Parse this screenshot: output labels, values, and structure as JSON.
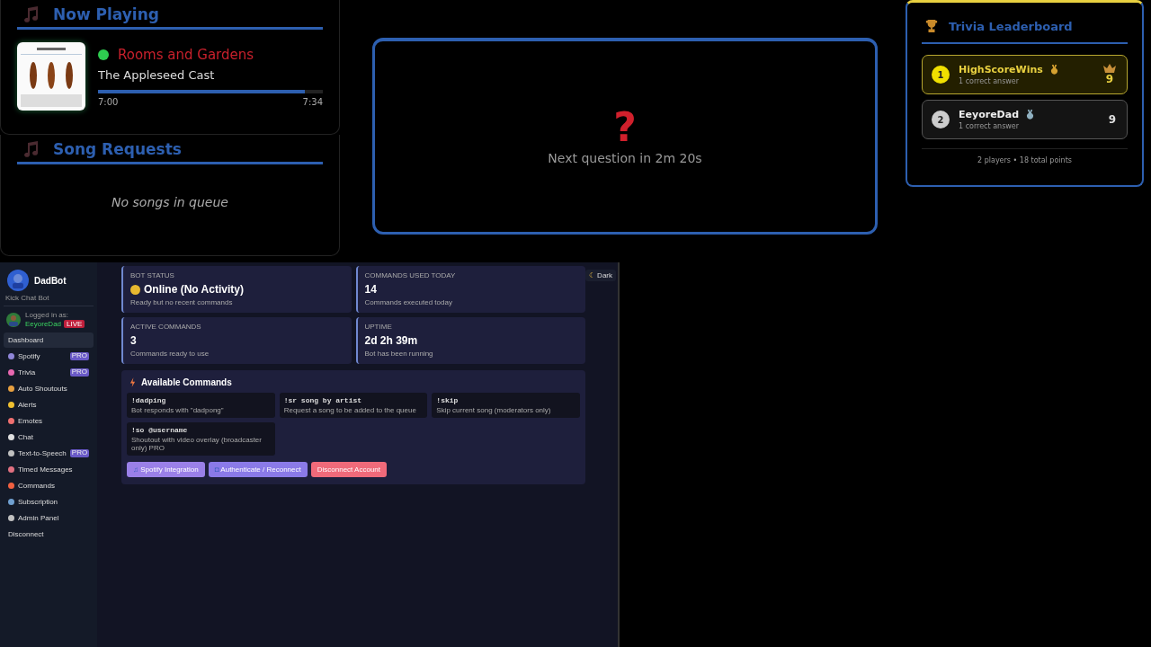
{
  "now_playing": {
    "title": "Now Playing",
    "playing": true,
    "track": "Rooms and Gardens",
    "artist": "The Appleseed Cast",
    "level": 0.92,
    "elapsed": "7:00",
    "duration": "7:34"
  },
  "song_requests": {
    "title": "Song Requests",
    "empty_text": "No songs in queue"
  },
  "trivia_question": {
    "mark": "?",
    "countdown": "Next question in 2m 20s"
  },
  "leaderboard": {
    "title": "Trivia Leaderboard",
    "players": [
      {
        "rank": "1",
        "name": "HighScoreWins",
        "detail": "1 correct answer",
        "score": "9",
        "leader": true
      },
      {
        "rank": "2",
        "name": "EeyoreDad",
        "detail": "1 correct answer",
        "score": "9",
        "leader": false
      }
    ],
    "footer": "2 players • 18 total points"
  },
  "dashboard": {
    "brand": "DadBot",
    "subtitle": "Kick Chat Bot",
    "logged_in_label": "Logged in as:",
    "user": "EeyoreDad",
    "live_badge": "LIVE",
    "theme_toggle": {
      "icon": "☾",
      "label": "Dark"
    },
    "sidebar": [
      {
        "label": "Dashboard",
        "selected": true
      },
      {
        "label": "Spotify",
        "selected": false,
        "badge": "PRO",
        "color": "#8f86d8"
      },
      {
        "label": "Trivia",
        "selected": false,
        "badge": "PRO",
        "color": "#e868b0"
      },
      {
        "label": "Auto Shoutouts",
        "selected": false,
        "color": "#e8a040"
      },
      {
        "label": "Alerts",
        "selected": false,
        "color": "#f0c030"
      },
      {
        "label": "Emotes",
        "selected": false,
        "color": "#f07070"
      },
      {
        "label": "Chat",
        "selected": false,
        "color": "#e0e0e0"
      },
      {
        "label": "Text-to-Speech",
        "selected": false,
        "badge": "PRO",
        "color": "#c0c0c0"
      },
      {
        "label": "Timed Messages",
        "selected": false,
        "color": "#e07080"
      },
      {
        "label": "Commands",
        "selected": false,
        "color": "#f06040"
      },
      {
        "label": "Subscription",
        "selected": false,
        "color": "#70a0d0"
      },
      {
        "label": "Admin Panel",
        "selected": false,
        "color": "#c0c0c0"
      }
    ],
    "disconnect": "Disconnect",
    "stats": [
      {
        "label": "BOT STATUS",
        "value": "Online (No Activity)",
        "caption": "Ready but no recent commands",
        "status_dot": true
      },
      {
        "label": "COMMANDS USED TODAY",
        "value": "14",
        "caption": "Commands executed today",
        "status_dot": false
      },
      {
        "label": "ACTIVE COMMANDS",
        "value": "3",
        "caption": "Commands ready to use",
        "status_dot": false
      },
      {
        "label": "UPTIME",
        "value": "2d 2h 39m",
        "caption": "Bot has been running",
        "status_dot": false
      }
    ],
    "commands_title": "Available Commands",
    "commands": [
      {
        "command": "!dadping",
        "description": "Bot responds with \"dadpong\""
      },
      {
        "command": "!sr song by artist",
        "description": "Request a song to be added to the queue"
      },
      {
        "command": "!skip",
        "description": "Skip current song (moderators only)"
      },
      {
        "command": "!so @username",
        "description": "Shoutout with video overlay (broadcaster only) PRO"
      }
    ],
    "actions": [
      {
        "kind": "spotify",
        "icon": "♫",
        "label": "Spotify Integration"
      },
      {
        "kind": "auth",
        "icon": "◘",
        "label": "Authenticate / Reconnect"
      },
      {
        "kind": "danger",
        "label": "Disconnect Account"
      }
    ]
  }
}
